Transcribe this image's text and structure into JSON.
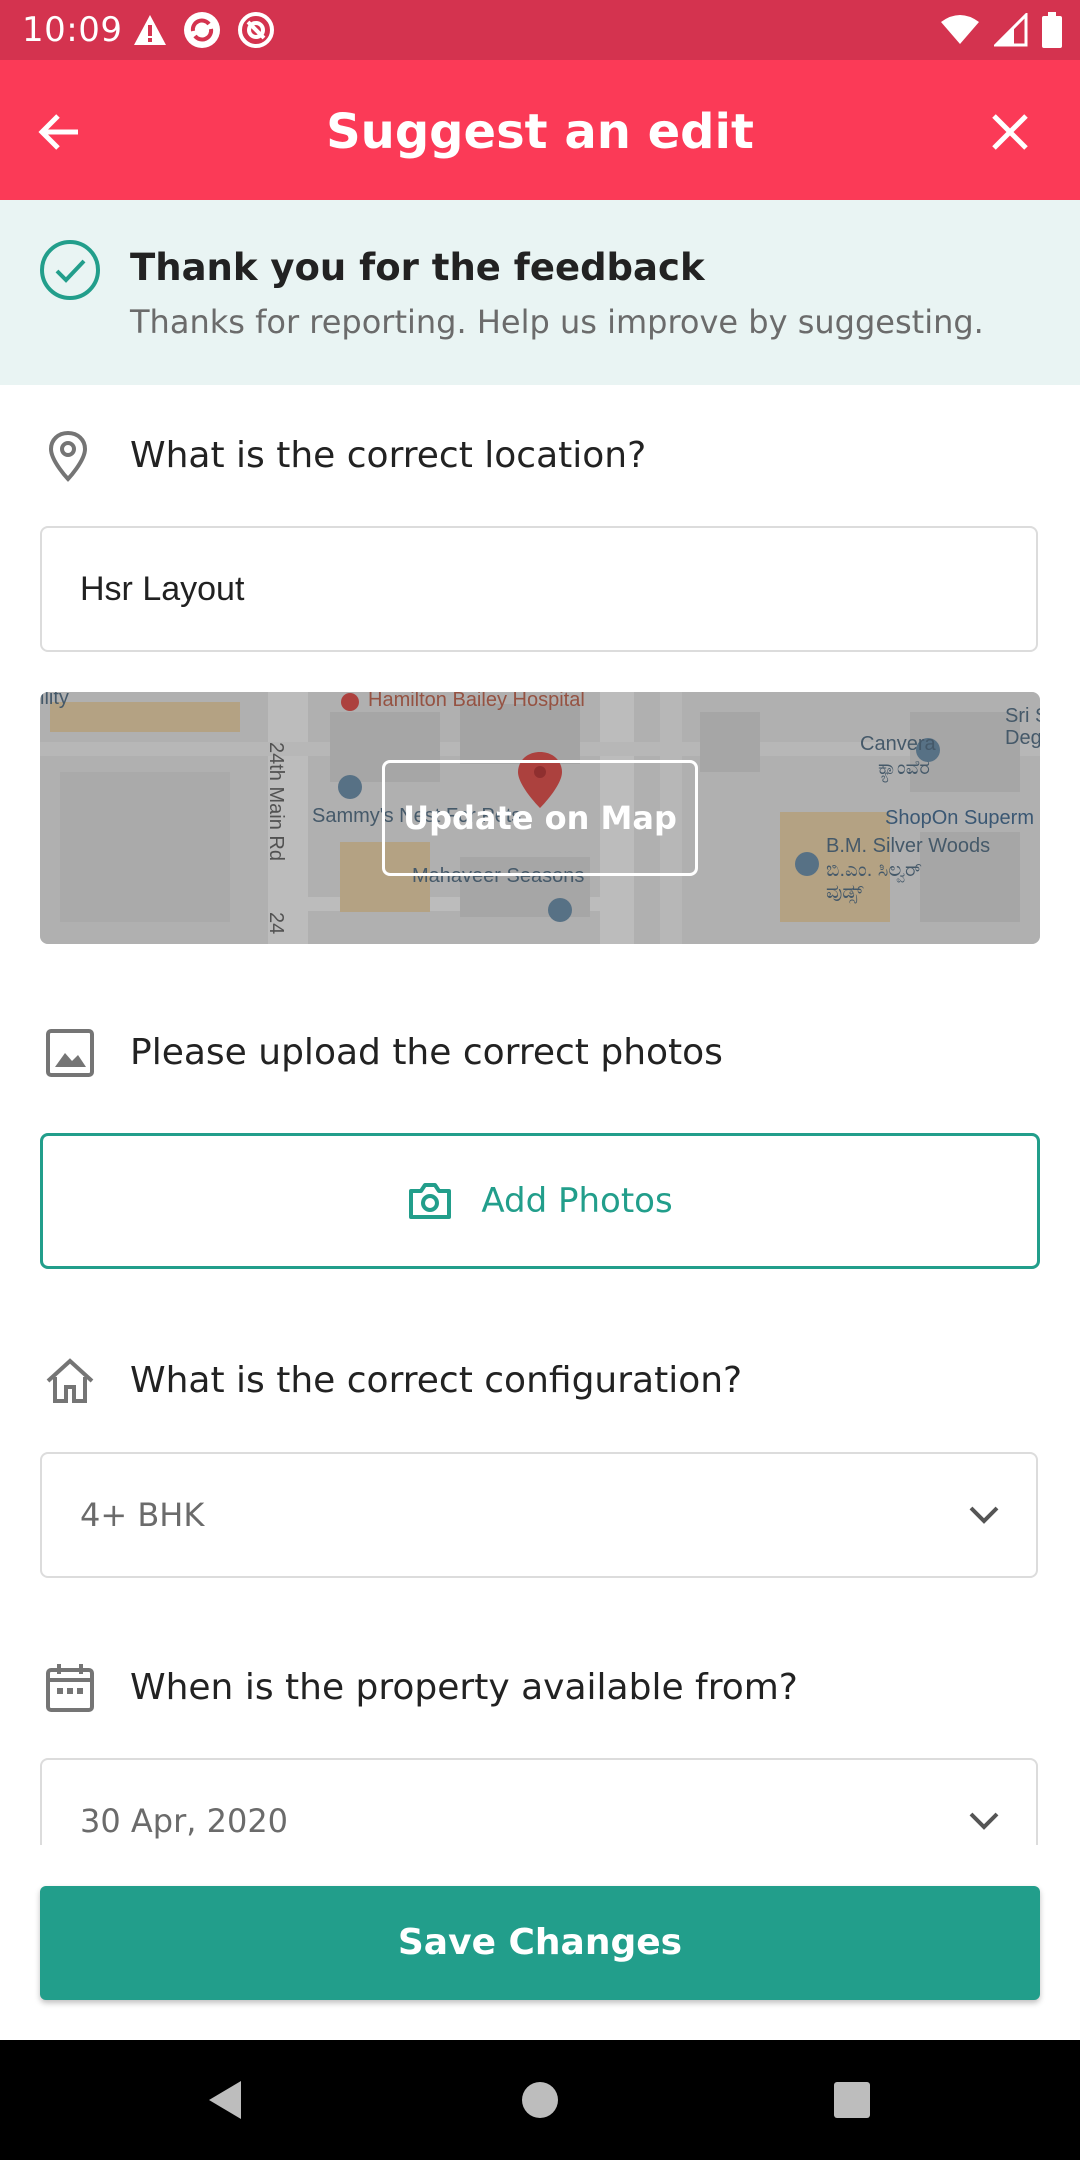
{
  "status_bar": {
    "time": "10:09",
    "left_icons": [
      "warning-icon",
      "sync-icon",
      "do-not-disturb-icon"
    ],
    "right_icons": [
      "wifi-icon",
      "signal-icon",
      "battery-icon"
    ]
  },
  "app_bar": {
    "title": "Suggest an edit",
    "back_icon": "arrow-back-icon",
    "close_icon": "close-icon",
    "color": "#fb3a57"
  },
  "feedback": {
    "title": "Thank you for the feedback",
    "subtitle": "Thanks for reporting. Help us improve by suggesting."
  },
  "location": {
    "question": "What is the correct location?",
    "value": "Hsr Layout",
    "map_button": "Update on Map",
    "map_labels": {
      "hospital": "Hamilton Bailey Hospital",
      "road": "24th Main Rd",
      "road_short": "24",
      "store1": "Sammy's Nest For Pets",
      "store2": "Mahaveer Seasons",
      "canvera": "Canvera",
      "canvera_kn": "ಕ್ಯಾಂವೆರ",
      "shopon": "ShopOn Superm",
      "bm": "B.M. Silver Woods",
      "bm_kn": "ಬಿ.ಎಂ. ಸಿಲ್ವರ್",
      "bm_kn2": "ವುಡ್ಸ್",
      "sri": "Sri S",
      "deg": "Deg",
      "left_frag": "ility"
    }
  },
  "photos": {
    "question": "Please upload the correct photos",
    "button": "Add Photos"
  },
  "configuration": {
    "question": "What is the correct configuration?",
    "selected": "4+ BHK"
  },
  "availability": {
    "question": "When is the property available from?",
    "selected": "30 Apr, 2020"
  },
  "actions": {
    "save": "Save Changes"
  },
  "colors": {
    "primary": "#fb3a57",
    "teal": "#229e8b",
    "banner_bg": "#e9f4f3"
  }
}
